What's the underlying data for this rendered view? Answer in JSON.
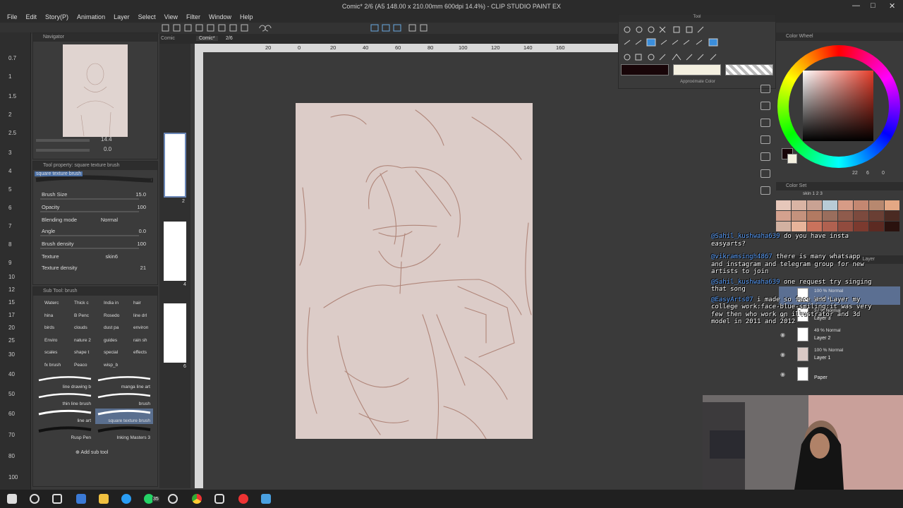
{
  "window": {
    "title": "Comic* 2/6 (A5 148.00 x 210.00mm 600dpi 14.4%) - CLIP STUDIO PAINT EX",
    "controls": [
      "—",
      "□",
      "✕"
    ]
  },
  "menu": [
    "File",
    "Edit",
    "Story(P)",
    "Animation",
    "Layer",
    "Select",
    "View",
    "Filter",
    "Window",
    "Help"
  ],
  "left_ruler": {
    "numbers": [
      "0.7",
      "1",
      "1.5",
      "2",
      "2.5",
      "3",
      "4",
      "5",
      "6",
      "7",
      "8",
      "9",
      "10",
      "12",
      "15",
      "17",
      "20",
      "25",
      "30",
      "40",
      "50",
      "60",
      "70",
      "80",
      "100"
    ]
  },
  "navigator": {
    "tab_label": "Navigator",
    "zoom": "14.4",
    "rotation": "0.0"
  },
  "tool_property": {
    "header": "Tool property: square texture brush",
    "brush_name": "square texture brush",
    "rows": [
      {
        "label": "Brush Size",
        "value": "15.0"
      },
      {
        "label": "Opacity",
        "value": "100"
      },
      {
        "label": "Blending mode",
        "value": "Normal"
      },
      {
        "label": "Angle",
        "value": "0.0"
      },
      {
        "label": "Brush density",
        "value": "100"
      },
      {
        "label": "Texture",
        "value": "skin6"
      },
      {
        "label": "Texture density",
        "value": "21"
      }
    ]
  },
  "sub_tool": {
    "header": "Sub Tool: brush",
    "grid": [
      "Waterc",
      "Thick c",
      "India in",
      "hair",
      "hina",
      "B Penc",
      "Rosedo",
      "line drl",
      "birds",
      "clouds",
      "dust pa",
      "environ",
      "Enviro",
      "nature 2",
      "guides",
      "rain sh",
      "scales",
      "shape t",
      "special",
      "effects",
      "fx brush",
      "Peaco",
      "wisp_b"
    ],
    "brushes": [
      "line drawing b",
      "manga line art",
      "thin line brush",
      "brush",
      "line art",
      "square texture brush",
      "Rusp Pen",
      "Inking Masters 3"
    ],
    "add_label": "Add sub tool"
  },
  "pages": [
    "2",
    "4",
    "6"
  ],
  "canvas": {
    "tabs": [
      "Comic",
      "Comic*"
    ],
    "tab_page": "2/6",
    "ruler_ticks": [
      "20",
      "0",
      "20",
      "40",
      "60",
      "80",
      "100",
      "120",
      "140",
      "160"
    ]
  },
  "tool_palette": {
    "title": "Tool",
    "approx_label": "Approximate Color"
  },
  "color_wheel": {
    "tab_label": "Color Wheel",
    "values": [
      "22",
      "6",
      "0"
    ]
  },
  "color_set": {
    "tab_label": "Color Set",
    "set_name": "skin 1 2 3",
    "swatches": [
      "#e6c7ba",
      "#d9b4a4",
      "#c9a293",
      "#b8cbd6",
      "#d79b86",
      "#c48771",
      "#b7886f",
      "#e4a884",
      "#d4a18e",
      "#c4927d",
      "#b27a62",
      "#9a6e5d",
      "#8f5b4c",
      "#7c4a3e",
      "#6a3f34",
      "#4a2a22",
      "#d2b1a1",
      "#e8b49a",
      "#c9725c",
      "#b06150",
      "#914b3e",
      "#7b3a2f",
      "#5c2a22",
      "#2a120e"
    ]
  },
  "layers": {
    "tab_label": "Layer",
    "items": [
      {
        "mode": "100 % Normal",
        "name": "Layer 4"
      },
      {
        "mode": "37 % Normal",
        "name": "Layer 3"
      },
      {
        "mode": "49 % Normal",
        "name": "Layer 2"
      },
      {
        "mode": "100 % Normal",
        "name": "Layer 1"
      },
      {
        "mode": "",
        "name": "Paper"
      }
    ]
  },
  "chat": [
    {
      "user": "@Sahil_kushwaha639",
      "text": " do you have insta easyarts?"
    },
    {
      "user": "@vikramsingh4867",
      "text": " there is many whatsapp and instagram and telegram group for new artists to join"
    },
    {
      "user": "@Sahil_kushwaha639",
      "text": " one request try singing that song"
    },
    {
      "user": "@EasyArts07",
      "text": " i made so face and Layer my college work:face-blue-smiling:it was very few then who work on illustrator and 3d model in 2011 and 2012"
    }
  ],
  "taskbar": {
    "badge": "35"
  }
}
